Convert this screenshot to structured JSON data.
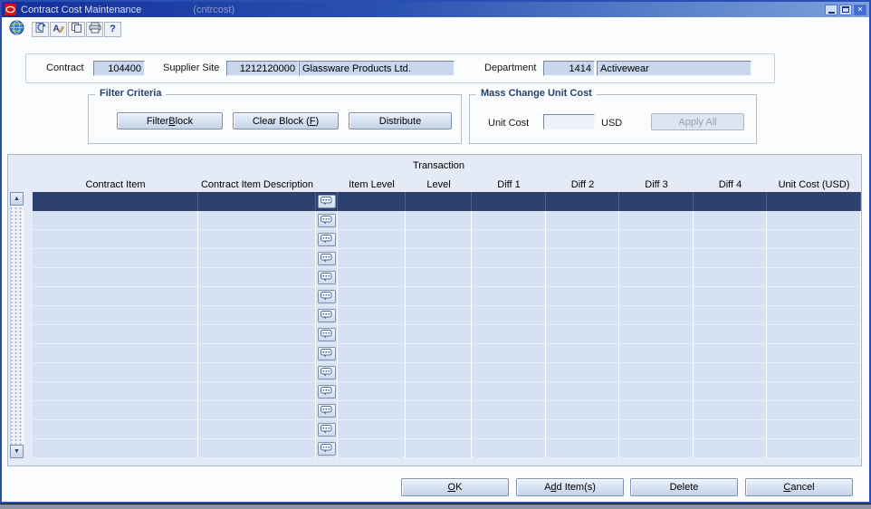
{
  "window": {
    "title": "Contract Cost Maintenance",
    "app_id": "(cntrcost)",
    "controls": [
      "minimize",
      "maximize",
      "close"
    ]
  },
  "toolbar": {
    "icons": [
      "globe",
      "clear-field",
      "edit",
      "copy",
      "print",
      "help"
    ]
  },
  "header": {
    "contract_label": "Contract",
    "contract_value": "104400",
    "supplier_site_label": "Supplier Site",
    "supplier_site_code": "1212120000",
    "supplier_site_name": "Glassware Products Ltd.",
    "department_label": "Department",
    "department_code": "1414",
    "department_name": "Activewear"
  },
  "filter_criteria": {
    "title": "Filter Criteria",
    "buttons": [
      {
        "label": "Filter Block",
        "mnemonic": 7
      },
      {
        "label": "Clear Block (F)",
        "mnemonic": 13
      },
      {
        "label": "Distribute",
        "mnemonic": null
      }
    ]
  },
  "mass_change": {
    "title": "Mass Change Unit Cost",
    "unit_cost_label": "Unit Cost",
    "unit_cost_value": "",
    "currency": "USD",
    "apply_button": {
      "label": "Apply All",
      "mnemonic": null,
      "disabled": true
    }
  },
  "table": {
    "transaction_header": "Transaction",
    "columns": [
      "Contract Item",
      "Contract Item Description",
      "Item Level",
      "Level",
      "Diff 1",
      "Diff 2",
      "Diff 3",
      "Diff 4",
      "Unit Cost (USD)"
    ],
    "row_count": 14,
    "selected_row_index": 0,
    "rows": []
  },
  "footer": {
    "buttons": [
      {
        "label": "OK",
        "mnemonic": 0
      },
      {
        "label": "Add Item(s)",
        "mnemonic": 1
      },
      {
        "label": "Delete",
        "mnemonic": null
      },
      {
        "label": "Cancel",
        "mnemonic": 0
      }
    ]
  },
  "colors": {
    "titlebar_start": "#142f9b",
    "titlebar_end": "#7da2dc",
    "selection": "#2c4170",
    "table_panel": "#e4ebf7",
    "row": "#d6e1f3",
    "field": "#c9d7ed",
    "window_border": "#2a4fb4"
  }
}
